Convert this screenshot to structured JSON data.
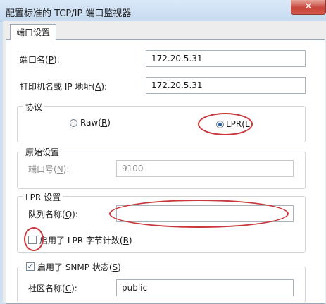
{
  "window": {
    "title": "配置标准的 TCP/IP 端口监视器",
    "close_glyph": "✕"
  },
  "tabs": [
    {
      "label": "端口设置"
    }
  ],
  "port_settings": {
    "port_name": {
      "label": "端口名(",
      "accel": "P",
      "suffix": "):",
      "value": "172.20.5.31"
    },
    "printer_address": {
      "label": "打印机名或 IP 地址(",
      "accel": "A",
      "suffix": "):",
      "value": "172.20.5.31"
    }
  },
  "protocol": {
    "group_label": "协议",
    "raw": {
      "label": "Raw(",
      "accel": "R",
      "suffix": ")",
      "checked": false
    },
    "lpr": {
      "label": "LPR(",
      "accel": "L",
      "suffix": ")",
      "checked": true
    }
  },
  "raw_settings": {
    "group_label": "原始设置",
    "port_number": {
      "label": "端口号(",
      "accel": "N",
      "suffix": "):",
      "value": "9100"
    }
  },
  "lpr_settings": {
    "group_label": "LPR 设置",
    "queue_name": {
      "label": "队列名称(",
      "accel": "Q",
      "suffix": "):",
      "value": ""
    },
    "byte_counting": {
      "label": "启用了 LPR 字节计数(",
      "accel": "B",
      "suffix": ")",
      "checked": false
    }
  },
  "snmp": {
    "enable": {
      "label": "启用了 SNMP 状态(",
      "accel": "S",
      "suffix": ")",
      "checked": true
    },
    "community": {
      "label": "社区名称(",
      "accel": "C",
      "suffix": "):",
      "value": "public"
    }
  },
  "colors": {
    "annotation": "#c8373b",
    "accent": "#1f5fa8"
  }
}
